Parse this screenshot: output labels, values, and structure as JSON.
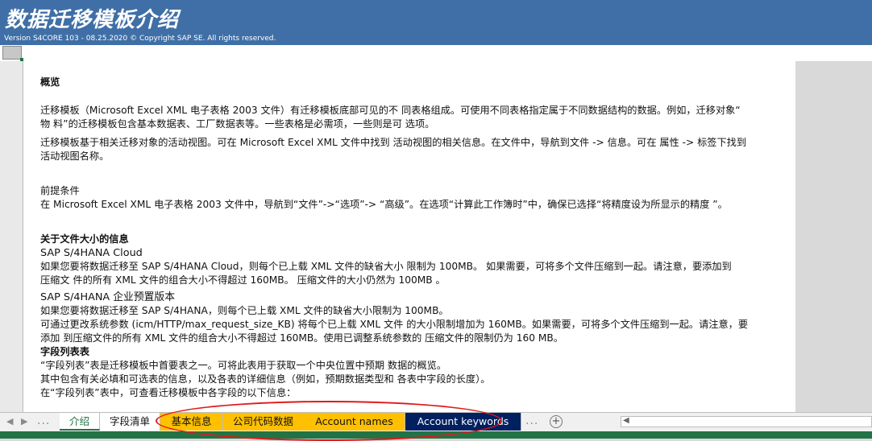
{
  "banner": {
    "title": "数据迁移模板介绍",
    "version": "Version S4CORE 103 - 08.25.2020 © Copyright SAP SE. All rights reserved."
  },
  "doc": {
    "overview_heading": "概览",
    "overview_p1_l1": "迁移模板（Microsoft Excel XML 电子表格 2003 文件）有迁移模板底部可见的不 同表格组成。可使用不同表格指定属于不同数据结构的数据。例如，迁移对象“",
    "overview_p1_l2": "物 料”的迁移模板包含基本数据表、工厂数据表等。一些表格是必需项，一些则是可 选项。",
    "overview_p2_l1": "迁移模板基于相关迁移对象的活动视图。可在 Microsoft Excel XML 文件中找到 活动视图的相关信息。在文件中，导航到文件 -> 信息。可在 属性 -> 标签下找到",
    "overview_p2_l2": "活动视图名称。",
    "prereq_heading": "前提条件",
    "prereq_text": "在 Microsoft Excel XML 电子表格 2003 文件中，导航到“文件”->“选项”-> “高级”。在选项“计算此工作簿时”中，确保已选择“将精度设为所显示的精度 ”。",
    "filesize_heading": "关于文件大小的信息",
    "cloud_heading": "SAP S/4HANA Cloud",
    "cloud_l1": "如果您要将数据迁移至 SAP S/4HANA Cloud，则每个已上载 XML 文件的缺省大小 限制为 100MB。   如果需要，可将多个文件压缩到一起。请注意，要添加到",
    "cloud_l2": "压缩文 件的所有 XML 文件的组合大小不得超过 160MB。   压缩文件的大小仍然为 100MB 。",
    "onprem_heading": "SAP S/4HANA 企业预置版本",
    "onprem_l1": "如果您要将数据迁移至 SAP S/4HANA，则每个已上载 XML 文件的缺省大小限制为  100MB。",
    "onprem_l2": "可通过更改系统参数 (icm/HTTP/max_request_size_KB) 将每个已上载 XML 文件 的大小限制增加为 160MB。如果需要，可将多个文件压缩到一起。请注意，要",
    "onprem_l3": "添加 到压缩文件的所有 XML 文件的组合大小不得超过 160MB。使用已调整系统参数的 压缩文件的限制仍为 160 MB。",
    "fieldlist_heading": "字段列表表",
    "fieldlist_l1": "“字段列表”表是迁移模板中首要表之一。可将此表用于获取一个中央位置中预期 数据的概览。",
    "fieldlist_l2": "其中包含有关必填和可选表的信息，以及各表的详细信息（例如，预期数据类型和 各表中字段的长度）。",
    "fieldlist_l3": "在“字段列表”表中，可查看迁移模板中各字段的以下信息："
  },
  "tabs": [
    {
      "label": "介绍"
    },
    {
      "label": "字段清单"
    },
    {
      "label": "基本信息"
    },
    {
      "label": "公司代码数据"
    },
    {
      "label": "Account names"
    },
    {
      "label": "Account keywords"
    }
  ],
  "tabbar": {
    "more": "...",
    "add": "+",
    "scroll_left": "◀"
  },
  "colors": {
    "banner": "#3f6fa6",
    "yellow_tab": "#ffc000",
    "navy_tab": "#002060",
    "excel_green": "#217346",
    "annotation_red": "#e01919"
  }
}
